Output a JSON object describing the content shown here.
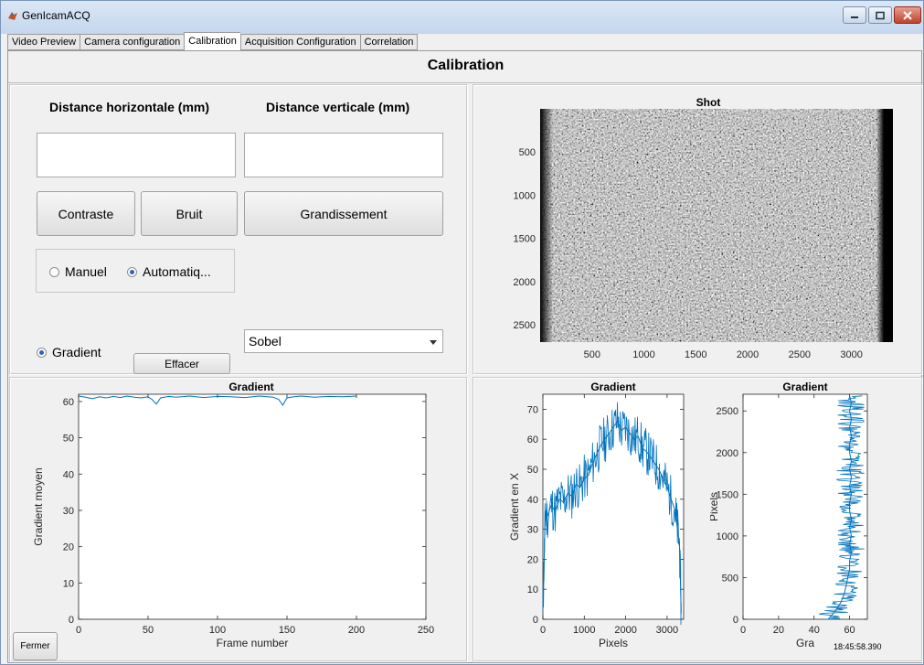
{
  "window": {
    "title": "GenIcamACQ"
  },
  "tabs": [
    {
      "label": "Video Preview",
      "active": false
    },
    {
      "label": "Camera configuration",
      "active": false
    },
    {
      "label": "Calibration",
      "active": true
    },
    {
      "label": "Acquisition Configuration",
      "active": false
    },
    {
      "label": "Correlation",
      "active": false
    }
  ],
  "page": {
    "title": "Calibration"
  },
  "controls": {
    "horizontal_label": "Distance horizontale (mm)",
    "vertical_label": "Distance verticale (mm)",
    "horizontal_value": "",
    "vertical_value": "",
    "contrast_button": "Contraste",
    "noise_button": "Bruit",
    "magnification_button": "Grandissement",
    "mode_manual": "Manuel",
    "mode_auto": "Automatiq...",
    "selected_mode": "auto",
    "gradient_radio": "Gradient",
    "clear_button": "Effacer",
    "filter_select": "Sobel"
  },
  "footer": {
    "close_button": "Fermer",
    "timestamp": "18:45:58.390"
  },
  "colors": {
    "line": "#0072bd",
    "panel_bg": "#f0f0f0"
  },
  "chart_data": [
    {
      "type": "heatmap",
      "title": "Shot",
      "xticks": [
        500,
        1000,
        1500,
        2000,
        2500,
        3000
      ],
      "yticks": [
        500,
        1000,
        1500,
        2000,
        2500
      ],
      "xlim": [
        0,
        3400
      ],
      "ylim": [
        0,
        2700
      ],
      "y_reversed": true
    },
    {
      "type": "line",
      "title": "Gradient",
      "xlabel": "Frame number",
      "ylabel": "Gradient moyen",
      "xlim": [
        0,
        250
      ],
      "ylim": [
        0,
        62
      ],
      "xticks": [
        0,
        50,
        100,
        150,
        200,
        250
      ],
      "yticks": [
        0,
        10,
        20,
        30,
        40,
        50,
        60
      ],
      "series": [
        {
          "x": [
            0,
            5,
            10,
            15,
            20,
            25,
            30,
            35,
            40,
            45,
            50,
            53,
            56,
            59,
            65,
            70,
            80,
            90,
            100,
            110,
            120,
            130,
            140,
            144,
            147,
            150,
            155,
            160,
            170,
            180,
            190,
            200
          ],
          "y": [
            61.5,
            61.2,
            60.8,
            61.3,
            61.0,
            61.4,
            61.1,
            61.5,
            61.2,
            61.0,
            61.3,
            60.5,
            59.3,
            61.0,
            61.4,
            61.2,
            61.5,
            61.1,
            61.4,
            61.3,
            61.1,
            61.5,
            61.2,
            60.6,
            59.0,
            61.0,
            61.3,
            61.5,
            61.2,
            61.4,
            61.3,
            61.5
          ]
        }
      ]
    },
    {
      "type": "line",
      "title": "Gradient",
      "xlabel": "Pixels",
      "ylabel": "Gradient en X",
      "xlim": [
        0,
        3400
      ],
      "ylim": [
        0,
        75
      ],
      "xticks": [
        0,
        1000,
        2000,
        3000
      ],
      "yticks": [
        0,
        10,
        20,
        30,
        40,
        50,
        60,
        70
      ],
      "series": [
        {
          "x": [
            0,
            30,
            60,
            100,
            200,
            300,
            400,
            500,
            600,
            700,
            800,
            900,
            1000,
            1100,
            1200,
            1300,
            1400,
            1500,
            1600,
            1700,
            1800,
            1900,
            2000,
            2100,
            2200,
            2300,
            2400,
            2500,
            2600,
            2700,
            2800,
            2900,
            3000,
            3100,
            3200,
            3250,
            3300,
            3340
          ],
          "y": [
            3,
            20,
            36,
            34,
            38,
            36,
            40,
            39,
            42,
            41,
            45,
            44,
            47,
            48,
            52,
            55,
            58,
            60,
            62,
            64,
            66,
            63,
            64,
            62,
            60,
            61,
            57,
            56,
            54,
            52,
            50,
            47,
            44,
            40,
            36,
            30,
            25,
            2
          ]
        }
      ]
    },
    {
      "type": "line",
      "title": "Gradient",
      "xlabel": "Gra",
      "ylabel": "Pixels",
      "xlim": [
        0,
        70
      ],
      "ylim": [
        0,
        2700
      ],
      "xticks": [
        0,
        20,
        40,
        60
      ],
      "yticks": [
        0,
        500,
        1000,
        1500,
        2000,
        2500
      ],
      "series": [
        {
          "x": [
            48,
            52,
            55,
            57,
            58,
            59,
            60,
            60,
            61,
            60,
            61,
            60,
            61,
            60,
            60,
            61,
            60,
            61,
            60,
            61,
            60,
            60,
            61,
            60,
            61,
            60,
            61,
            60
          ],
          "y": [
            0,
            100,
            200,
            300,
            400,
            500,
            600,
            700,
            800,
            900,
            1000,
            1100,
            1200,
            1300,
            1400,
            1500,
            1600,
            1700,
            1800,
            1900,
            2000,
            2100,
            2200,
            2300,
            2400,
            2500,
            2600,
            2680
          ]
        }
      ]
    }
  ]
}
